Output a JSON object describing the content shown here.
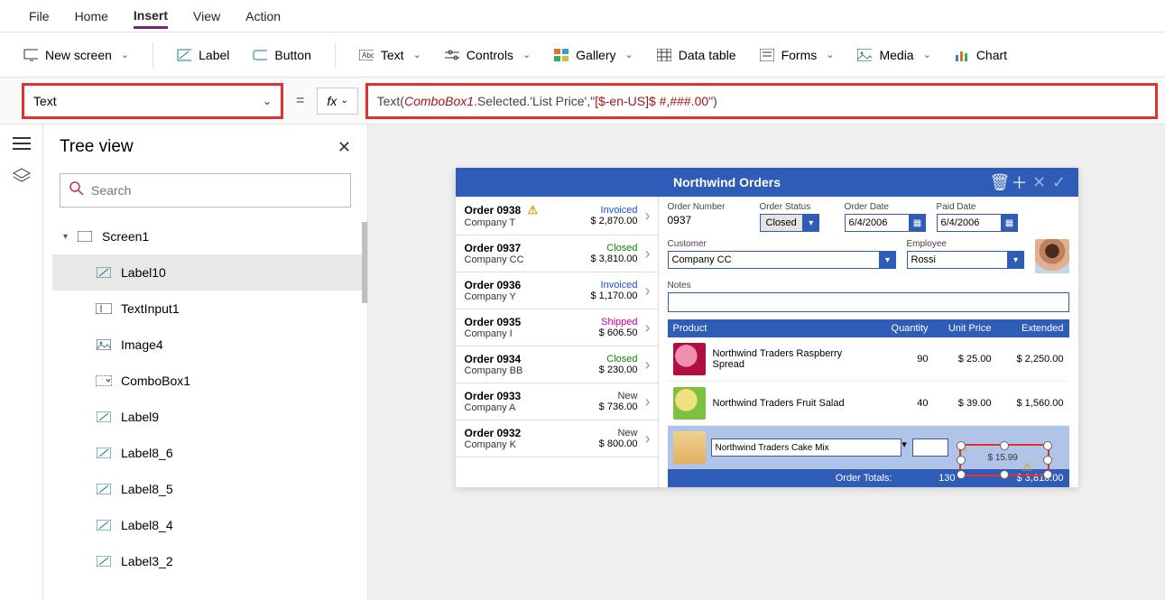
{
  "menu": {
    "items": [
      "File",
      "Home",
      "Insert",
      "View",
      "Action"
    ],
    "active_index": 2
  },
  "ribbon": {
    "new_screen": "New screen",
    "label": "Label",
    "button": "Button",
    "text": "Text",
    "controls": "Controls",
    "gallery": "Gallery",
    "data_table": "Data table",
    "forms": "Forms",
    "media": "Media",
    "chart": "Chart"
  },
  "formula": {
    "property": "Text",
    "equals": "=",
    "fx": "fx",
    "fn_open": "Text(",
    "ctrl": " ComboBox1",
    "path": ".Selected.'List Price', ",
    "fmt": "\"[$-en-US]$ #,###.00\"",
    "close": " )"
  },
  "tree": {
    "title": "Tree view",
    "search_placeholder": "Search",
    "root": "Screen1",
    "children": [
      {
        "label": "Label10",
        "icon": "label",
        "selected": true
      },
      {
        "label": "TextInput1",
        "icon": "textinput"
      },
      {
        "label": "Image4",
        "icon": "image"
      },
      {
        "label": "ComboBox1",
        "icon": "combo"
      },
      {
        "label": "Label9",
        "icon": "label"
      },
      {
        "label": "Label8_6",
        "icon": "label"
      },
      {
        "label": "Label8_5",
        "icon": "label"
      },
      {
        "label": "Label8_4",
        "icon": "label"
      },
      {
        "label": "Label3_2",
        "icon": "label"
      }
    ]
  },
  "app": {
    "title": "Northwind Orders",
    "orders": [
      {
        "id": "Order 0938",
        "company": "Company T",
        "status": "Invoiced",
        "amount": "$ 2,870.00",
        "warn": true
      },
      {
        "id": "Order 0937",
        "company": "Company CC",
        "status": "Closed",
        "amount": "$ 3,810.00"
      },
      {
        "id": "Order 0936",
        "company": "Company Y",
        "status": "Invoiced",
        "amount": "$ 1,170.00"
      },
      {
        "id": "Order 0935",
        "company": "Company I",
        "status": "Shipped",
        "amount": "$ 606.50"
      },
      {
        "id": "Order 0934",
        "company": "Company BB",
        "status": "Closed",
        "amount": "$ 230.00"
      },
      {
        "id": "Order 0933",
        "company": "Company A",
        "status": "New",
        "amount": "$ 736.00"
      },
      {
        "id": "Order 0932",
        "company": "Company K",
        "status": "New",
        "amount": "$ 800.00"
      }
    ],
    "detail": {
      "order_number_label": "Order Number",
      "order_number": "0937",
      "order_status_label": "Order Status",
      "order_status": "Closed",
      "order_date_label": "Order Date",
      "order_date": "6/4/2006",
      "paid_date_label": "Paid Date",
      "paid_date": "6/4/2006",
      "customer_label": "Customer",
      "customer": "Company CC",
      "employee_label": "Employee",
      "employee": "Rossi",
      "notes_label": "Notes"
    },
    "products_head": {
      "product": "Product",
      "qty": "Quantity",
      "unit": "Unit Price",
      "ext": "Extended"
    },
    "products": [
      {
        "name": "Northwind Traders Raspberry Spread",
        "qty": "90",
        "unit": "$ 25.00",
        "ext": "$ 2,250.00",
        "color1": "#b01040",
        "color2": "#f090b0"
      },
      {
        "name": "Northwind Traders Fruit Salad",
        "qty": "40",
        "unit": "$ 39.00",
        "ext": "$ 1,560.00",
        "color1": "#80c040",
        "color2": "#f0e080"
      }
    ],
    "edit": {
      "combo": "Northwind Traders Cake Mix",
      "price": "$ 15.99"
    },
    "totals": {
      "label": "Order Totals:",
      "qty": "130",
      "amount": "$ 3,810.00"
    }
  }
}
